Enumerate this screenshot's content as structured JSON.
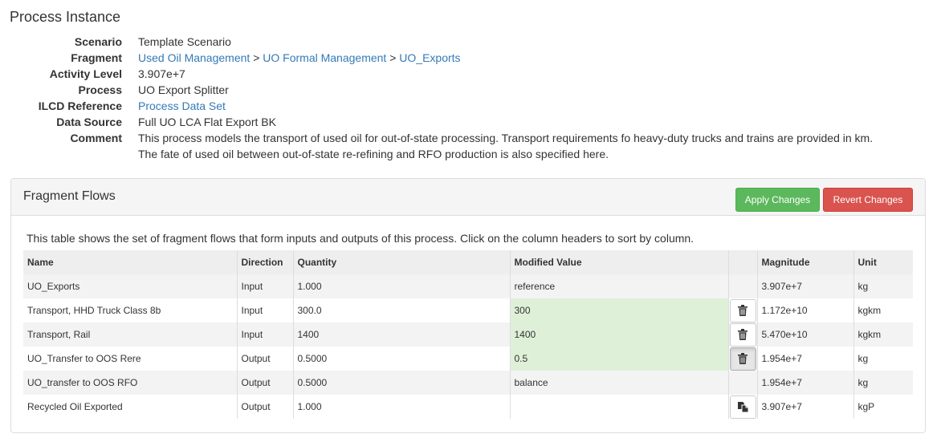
{
  "page_title": "Process Instance",
  "details": {
    "scenario_label": "Scenario",
    "scenario_value": "Template Scenario",
    "fragment_label": "Fragment",
    "fragment_links": [
      "Used Oil Management",
      "UO Formal Management",
      "UO_Exports"
    ],
    "fragment_separator": ">",
    "activity_label": "Activity Level",
    "activity_value": "3.907e+7",
    "process_label": "Process",
    "process_value": "UO Export Splitter",
    "ilcd_label": "ILCD Reference",
    "ilcd_link": "Process Data Set",
    "datasource_label": "Data Source",
    "datasource_value": "Full UO LCA Flat Export BK",
    "comment_label": "Comment",
    "comment_line1": "This process models the transport of used oil for out-of-state processing.  Transport requirements fo heavy-duty trucks and trains are provided in km.",
    "comment_line2": "The fate of used oil between out-of-state re-refining and RFO production is also specified here."
  },
  "panel": {
    "title": "Fragment Flows",
    "apply_label": "Apply Changes",
    "revert_label": "Revert Changes",
    "apply_color": "#5cb85c",
    "revert_color": "#d9534f",
    "note": "This table shows the set of fragment flows that form inputs and outputs of this process. Click on the column headers to sort by column."
  },
  "table": {
    "headers": {
      "name": "Name",
      "direction": "Direction",
      "quantity": "Quantity",
      "modified": "Modified Value",
      "action": "",
      "magnitude": "Magnitude",
      "unit": "Unit"
    },
    "rows": [
      {
        "name": "UO_Exports",
        "direction": "Input",
        "quantity": "1.000",
        "modified": "reference",
        "icon": "",
        "magnitude": "3.907e+7",
        "unit": "kg"
      },
      {
        "name": "Transport, HHD Truck Class 8b",
        "direction": "Input",
        "quantity": "300.0",
        "modified": "300",
        "icon": "trash-icon",
        "magnitude": "1.172e+10",
        "unit": "kgkm"
      },
      {
        "name": "Transport, Rail",
        "direction": "Input",
        "quantity": "1400",
        "modified": "1400",
        "icon": "trash-icon",
        "magnitude": "5.470e+10",
        "unit": "kgkm"
      },
      {
        "name": "UO_Transfer to OOS Rere",
        "direction": "Output",
        "quantity": "0.5000",
        "modified": "0.5",
        "icon": "trash-icon",
        "magnitude": "1.954e+7",
        "unit": "kg"
      },
      {
        "name": "UO_transfer to OOS RFO",
        "direction": "Output",
        "quantity": "0.5000",
        "modified": "balance",
        "icon": "",
        "magnitude": "1.954e+7",
        "unit": "kg"
      },
      {
        "name": "Recycled Oil Exported",
        "direction": "Output",
        "quantity": "1.000",
        "modified": "",
        "icon": "copy-icon",
        "magnitude": "3.907e+7",
        "unit": "kgP"
      }
    ]
  },
  "colors": {
    "link": "#337ab7",
    "modified_bg": "#dff0d8",
    "header_bg": "#eeeeee",
    "stripe_bg": "#f3f3f3"
  }
}
